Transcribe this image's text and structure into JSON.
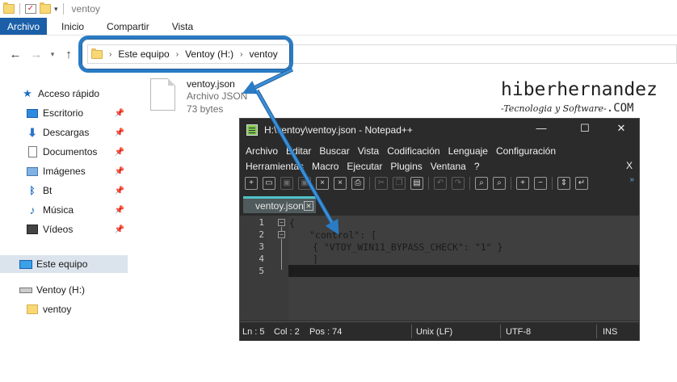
{
  "window": {
    "title": "ventoy",
    "ribbon_tabs": [
      "Archivo",
      "Inicio",
      "Compartir",
      "Vista"
    ]
  },
  "address": {
    "crumbs": [
      "Este equipo",
      "Ventoy (H:)",
      "ventoy"
    ]
  },
  "sidebar": {
    "quick_access": "Acceso rápido",
    "items": [
      {
        "label": "Escritorio",
        "icon": "desktop-icon",
        "pinned": true
      },
      {
        "label": "Descargas",
        "icon": "download-icon",
        "pinned": true
      },
      {
        "label": "Documentos",
        "icon": "documents-icon",
        "pinned": true
      },
      {
        "label": "Imágenes",
        "icon": "pictures-icon",
        "pinned": true
      },
      {
        "label": "Bt",
        "icon": "bluetooth-icon",
        "pinned": true
      },
      {
        "label": "Música",
        "icon": "music-icon",
        "pinned": true
      },
      {
        "label": "Vídeos",
        "icon": "videos-icon",
        "pinned": true
      }
    ],
    "this_pc": "Este equipo",
    "drive": "Ventoy (H:)",
    "folder": "ventoy"
  },
  "file": {
    "name": "ventoy.json",
    "type": "Archivo JSON",
    "size": "73 bytes"
  },
  "watermark": {
    "title": "hiberhernandez",
    "subtitle": "-Tecnologia y Software-",
    "domain": ".COM"
  },
  "notepad": {
    "title": "H:\\ventoy\\ventoy.json - Notepad++",
    "menu_row1": [
      "Archivo",
      "Editar",
      "Buscar",
      "Vista",
      "Codificación",
      "Lenguaje",
      "Configuración"
    ],
    "menu_row2": [
      "Herramientas",
      "Macro",
      "Ejecutar",
      "Plugins",
      "Ventana",
      "?"
    ],
    "menu_close": "X",
    "tab": "ventoy.json",
    "lines": [
      {
        "num": "1",
        "text": "{"
      },
      {
        "num": "2",
        "text": "\"control\": ["
      },
      {
        "num": "3",
        "text": "{ \"VTOY_WIN11_BYPASS_CHECK\": \"1\" }"
      },
      {
        "num": "4",
        "text": "]"
      },
      {
        "num": "5",
        "text": "}"
      }
    ],
    "status": {
      "ln": "Ln : 5",
      "col": "Col : 2",
      "pos": "Pos : 74",
      "eol": "Unix (LF)",
      "enc": "UTF-8",
      "ins": "INS"
    }
  },
  "colors": {
    "accent": "#1a5fa8",
    "highlight": "#2a7bc4",
    "npp_bg": "#2b2b2b",
    "editor_bg": "#3f3f3f",
    "string": "#7cc0f5"
  }
}
